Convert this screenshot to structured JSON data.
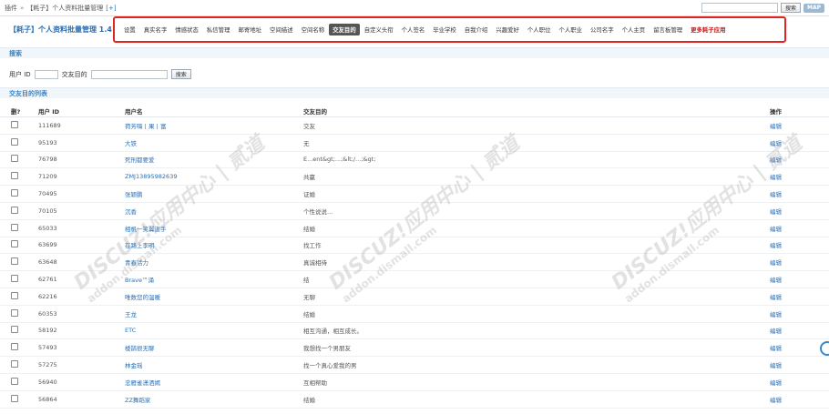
{
  "topbar": {
    "crumb_root": "插件",
    "crumb_sep": "»",
    "crumb_page": "【耗子】个人资料批量管理",
    "crumb_plus": "[+]",
    "search_button": "搜索",
    "map_button": "MAP"
  },
  "header": {
    "plugin_title": "【耗子】个人资料批量管理 1.4",
    "nav": [
      {
        "label": "设置"
      },
      {
        "label": "真实名字"
      },
      {
        "label": "情感状态"
      },
      {
        "label": "私信管理"
      },
      {
        "label": "邮寄地址"
      },
      {
        "label": "空间描述"
      },
      {
        "label": "空间名称"
      },
      {
        "label": "交友目的",
        "active": true
      },
      {
        "label": "自定义头衔"
      },
      {
        "label": "个人签名"
      },
      {
        "label": "毕业学校"
      },
      {
        "label": "自我介绍"
      },
      {
        "label": "兴趣爱好"
      },
      {
        "label": "个人职位"
      },
      {
        "label": "个人职业"
      },
      {
        "label": "公司名字"
      },
      {
        "label": "个人主页"
      },
      {
        "label": "留言板管理"
      },
      {
        "label": "更多耗子应用",
        "more": true
      }
    ]
  },
  "search": {
    "title": "搜索",
    "uid_label": "用户 ID",
    "purpose_label": "交友目的",
    "button": "搜索"
  },
  "list": {
    "title": "交友目的列表",
    "columns": [
      "删?",
      "用户 ID",
      "用户名",
      "交友目的",
      "操作"
    ],
    "action_label": "编辑",
    "rows": [
      {
        "uid": "111689",
        "username": "荷芳嗨丨果丨富",
        "purpose": "交友"
      },
      {
        "uid": "95193",
        "username": "大铁",
        "purpose": "无"
      },
      {
        "uid": "76798",
        "username": "死刑都要爱",
        "purpose": "E...ent&gt;...;&lt;/...;&gt;"
      },
      {
        "uid": "71209",
        "username": "ZMJ13895982639",
        "purpose": "共赢"
      },
      {
        "uid": "70495",
        "username": "张颖鹏",
        "purpose": "证婚"
      },
      {
        "uid": "70105",
        "username": "沉香",
        "purpose": "个性说说..."
      },
      {
        "uid": "65033",
        "username": "相帆一笑翼逝手",
        "purpose": "结婚"
      },
      {
        "uid": "63699",
        "username": "在路上李明",
        "purpose": "找工作"
      },
      {
        "uid": "63648",
        "username": "青春活力",
        "purpose": "真诚相待"
      },
      {
        "uid": "62761",
        "username": "Brave™涌",
        "purpose": "结"
      },
      {
        "uid": "62216",
        "username": "唯数您的温暖",
        "purpose": "无聊"
      },
      {
        "uid": "60353",
        "username": "王龙",
        "purpose": "结婚"
      },
      {
        "uid": "58192",
        "username": "ETC",
        "purpose": "相互沟通，相互成长。"
      },
      {
        "uid": "57493",
        "username": "楼鹊很无聊",
        "purpose": "我想找一个男朋友"
      },
      {
        "uid": "57275",
        "username": "林金瑶",
        "purpose": "找一个真心爱我的男"
      },
      {
        "uid": "56940",
        "username": "忠雁雀潇洒嫣",
        "purpose": "互相帮助"
      },
      {
        "uid": "56864",
        "username": "ZZ舞蹈家",
        "purpose": "结婚"
      }
    ]
  },
  "watermark": {
    "brand": "DISCUZ!应用中心 | 贰道",
    "domain": "addon.dismall.com"
  },
  "colors": {
    "accent": "#2a6fb5",
    "highlight_border": "#e02424",
    "active_tab": "#555555",
    "more_link": "#c21b1b"
  }
}
